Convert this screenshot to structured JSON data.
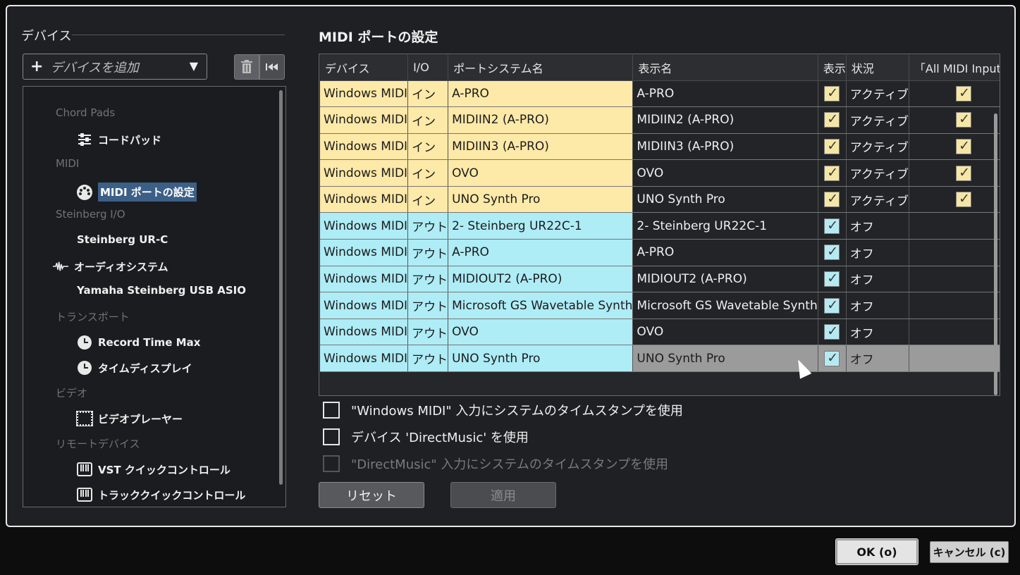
{
  "sidebar": {
    "title": "デバイス",
    "add_device_label": "デバイスを追加",
    "tree": [
      {
        "type": "category",
        "label": "Chord Pads"
      },
      {
        "type": "leaf",
        "icon": "sliders-icon",
        "label": "コードパッド"
      },
      {
        "type": "category",
        "label": "MIDI"
      },
      {
        "type": "leaf",
        "icon": "midi-din-icon",
        "label": "MIDI ポートの設定",
        "selected": true
      },
      {
        "type": "category",
        "label": "Steinberg I/O"
      },
      {
        "type": "leaf",
        "icon": "",
        "label": "Steinberg UR-C"
      },
      {
        "type": "leaf",
        "icon": "waveform-icon",
        "label": "オーディオシステム"
      },
      {
        "type": "leaf",
        "icon": "",
        "label": "Yamaha Steinberg USB ASIO"
      },
      {
        "type": "category",
        "label": "トランスポート"
      },
      {
        "type": "leaf",
        "icon": "clock-icon",
        "label": "Record Time Max"
      },
      {
        "type": "leaf",
        "icon": "clock-icon",
        "label": "タイムディスプレイ"
      },
      {
        "type": "category",
        "label": "ビデオ"
      },
      {
        "type": "leaf",
        "icon": "film-icon",
        "label": "ビデオプレーヤー"
      },
      {
        "type": "category",
        "label": "リモートデバイス"
      },
      {
        "type": "leaf",
        "icon": "keyboard-icon",
        "label": "VST クイックコントロール"
      },
      {
        "type": "leaf",
        "icon": "keyboard-icon",
        "label": "トラッククイックコントロール"
      }
    ]
  },
  "main": {
    "title": "MIDI ポートの設定",
    "columns": [
      "デバイス",
      "I/O",
      "ポートシステム名",
      "表示名",
      "表示",
      "状況",
      "「All MIDI Inputs」"
    ],
    "rows": [
      {
        "device": "Windows MIDI",
        "io": "イン",
        "port": "A-PRO",
        "display": "A-PRO",
        "visible": true,
        "status": "アクティブ",
        "all_midi": true,
        "kind": "in"
      },
      {
        "device": "Windows MIDI",
        "io": "イン",
        "port": "MIDIIN2 (A-PRO)",
        "display": "MIDIIN2 (A-PRO)",
        "visible": true,
        "status": "アクティブ",
        "all_midi": true,
        "kind": "in"
      },
      {
        "device": "Windows MIDI",
        "io": "イン",
        "port": "MIDIIN3 (A-PRO)",
        "display": "MIDIIN3 (A-PRO)",
        "visible": true,
        "status": "アクティブ",
        "all_midi": true,
        "kind": "in"
      },
      {
        "device": "Windows MIDI",
        "io": "イン",
        "port": "OVO",
        "display": "OVO",
        "visible": true,
        "status": "アクティブ",
        "all_midi": true,
        "kind": "in"
      },
      {
        "device": "Windows MIDI",
        "io": "イン",
        "port": "UNO Synth Pro",
        "display": "UNO Synth Pro",
        "visible": true,
        "status": "アクティブ",
        "all_midi": true,
        "kind": "in"
      },
      {
        "device": "Windows MIDI",
        "io": "アウト",
        "port": "2- Steinberg UR22C-1",
        "display": "2- Steinberg UR22C-1",
        "visible": true,
        "status": "オフ",
        "all_midi": false,
        "kind": "out"
      },
      {
        "device": "Windows MIDI",
        "io": "アウト",
        "port": "A-PRO",
        "display": "A-PRO",
        "visible": true,
        "status": "オフ",
        "all_midi": false,
        "kind": "out"
      },
      {
        "device": "Windows MIDI",
        "io": "アウト",
        "port": "MIDIOUT2 (A-PRO)",
        "display": "MIDIOUT2 (A-PRO)",
        "visible": true,
        "status": "オフ",
        "all_midi": false,
        "kind": "out"
      },
      {
        "device": "Windows MIDI",
        "io": "アウト",
        "port": "Microsoft GS Wavetable Synth",
        "display": "Microsoft GS Wavetable Synth",
        "visible": true,
        "status": "オフ",
        "all_midi": false,
        "kind": "out"
      },
      {
        "device": "Windows MIDI",
        "io": "アウト",
        "port": "OVO",
        "display": "OVO",
        "visible": true,
        "status": "オフ",
        "all_midi": false,
        "kind": "out"
      },
      {
        "device": "Windows MIDI",
        "io": "アウト",
        "port": "UNO Synth Pro",
        "display": "UNO Synth Pro",
        "visible": true,
        "status": "オフ",
        "all_midi": false,
        "kind": "out",
        "highlighted": true
      }
    ],
    "options": [
      {
        "label": "\"Windows MIDI\" 入力にシステムのタイムスタンプを使用",
        "checked": false,
        "disabled": false
      },
      {
        "label": "デバイス 'DirectMusic' を使用",
        "checked": false,
        "disabled": false
      },
      {
        "label": "\"DirectMusic\" 入力にシステムのタイムスタンプを使用",
        "checked": false,
        "disabled": true
      }
    ],
    "reset_label": "リセット",
    "apply_label": "適用"
  },
  "footer": {
    "ok_label": "OK (o)",
    "cancel_label": "キャンセル (c)"
  }
}
